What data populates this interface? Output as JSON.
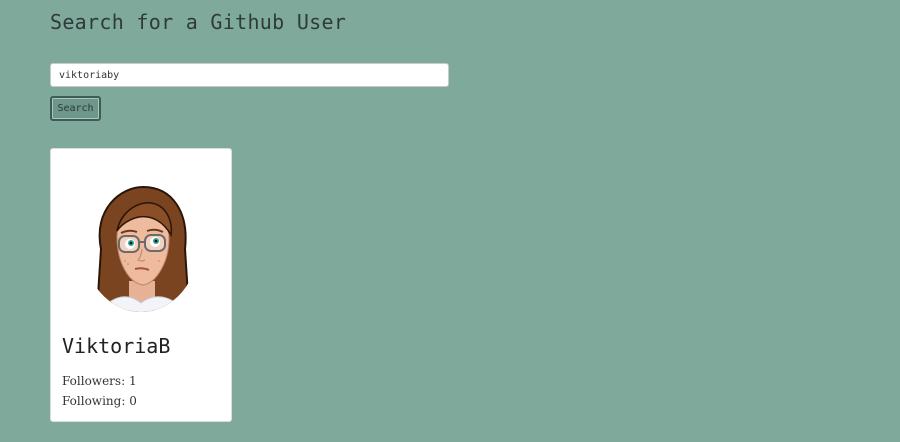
{
  "header": {
    "title": "Search for a Github User"
  },
  "search": {
    "value": "viktoriaby",
    "button_label": "Search"
  },
  "profile": {
    "name": "ViktoriaB",
    "followers_label": "Followers:",
    "followers_count": "1",
    "following_label": "Following:",
    "following_count": "0",
    "avatar_icon": "avatar-icon"
  },
  "colors": {
    "background": "#7fa99b",
    "button": "#6f968a",
    "card": "#ffffff"
  }
}
